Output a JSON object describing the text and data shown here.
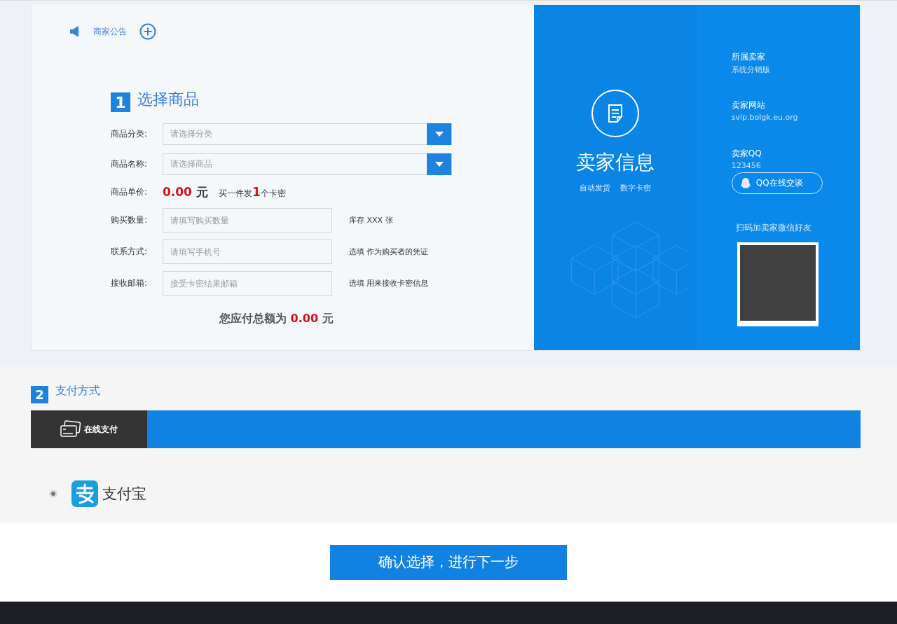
{
  "notice": {
    "label": "商家公告"
  },
  "step1": {
    "number": "1",
    "title": "选择商品"
  },
  "selects": [
    {
      "label": "商品分类:",
      "placeholder": "请选择分类"
    },
    {
      "label": "商品名称:",
      "placeholder": "请选择商品"
    }
  ],
  "price": {
    "label": "商品单价:",
    "amount": "0.00",
    "unit": "元",
    "note_before": "买一件发",
    "note_count": "1",
    "note_after": "个卡密"
  },
  "inputs": [
    {
      "label": "购买数量:",
      "placeholder": "请填写购买数量",
      "hint": "库存 XXX 张"
    },
    {
      "label": "联系方式:",
      "placeholder": "请填写手机号",
      "hint": "选填 作为购买者的凭证"
    },
    {
      "label": "接收邮箱:",
      "placeholder": "接受卡密结果邮箱",
      "hint": "选填 用来接收卡密信息"
    }
  ],
  "total": {
    "label": "您应付总额为",
    "amount": "0.00",
    "unit": "元"
  },
  "seller": {
    "title": "卖家信息",
    "tags": [
      "自动发货",
      "数字卡密"
    ],
    "fields": [
      {
        "label": "所属卖家",
        "value": "系统分销版"
      },
      {
        "label": "卖家网站",
        "value": "svip.bolgk.eu.org"
      },
      {
        "label": "卖家QQ",
        "value": "123456"
      }
    ],
    "qq_button": "QQ在线交谈",
    "qr_caption": "扫码加卖家微信好友"
  },
  "step2": {
    "number": "2",
    "title": "支付方式"
  },
  "pay_tabs": [
    {
      "label": "在线支付",
      "selected": true
    }
  ],
  "pay_methods": [
    {
      "label": "支付宝",
      "selected": true
    }
  ],
  "submit": "确认选择，进行下一步"
}
